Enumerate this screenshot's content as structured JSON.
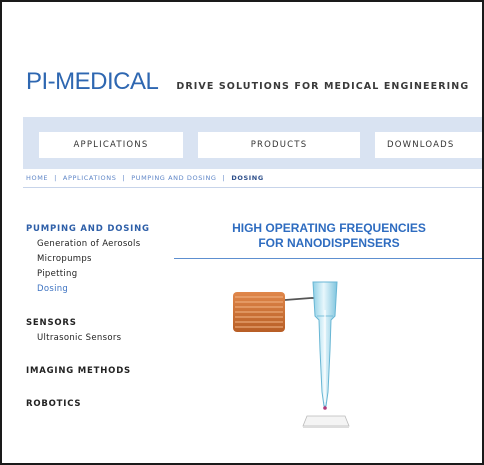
{
  "header": {
    "logo": "PI-MEDICAL",
    "tagline": "DRIVE SOLUTIONS FOR MEDICAL ENGINEERING"
  },
  "nav": {
    "tabs": [
      {
        "label": "APPLICATIONS"
      },
      {
        "label": "PRODUCTS"
      },
      {
        "label": "DOWNLOADS"
      }
    ]
  },
  "breadcrumb": {
    "items": [
      "HOME",
      "APPLICATIONS",
      "PUMPING AND DOSING",
      "DOSING"
    ],
    "separator": "|"
  },
  "sidebar": {
    "sections": [
      {
        "heading": "PUMPING AND DOSING",
        "items": [
          "Generation of Aerosols",
          "Micropumps",
          "Pipetting",
          "Dosing"
        ]
      },
      {
        "heading": "SENSORS",
        "items": [
          "Ultrasonic Sensors"
        ]
      },
      {
        "heading": "IMAGING METHODS",
        "items": []
      },
      {
        "heading": "ROBOTICS",
        "items": []
      }
    ]
  },
  "content": {
    "title_line1": "HIGH OPERATING FREQUENCIES",
    "title_line2": "FOR NANODISPENSERS"
  },
  "colors": {
    "brand_blue": "#2e67b1",
    "nav_band": "#d9e3f2",
    "link_blue": "#5f86c7",
    "active_blue": "#3f74c2",
    "actuator_orange": "#d87a3d",
    "pipette_cyan": "#b9e3ef"
  }
}
